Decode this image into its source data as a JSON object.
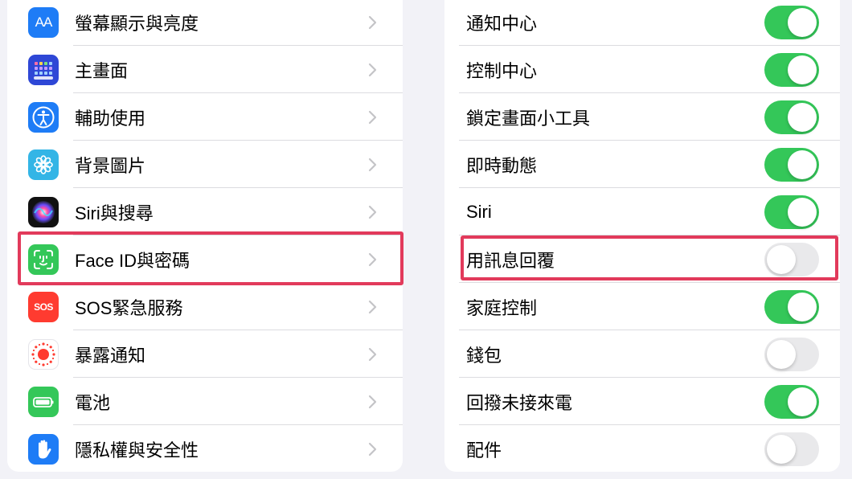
{
  "colors": {
    "toggle_on": "#34c759",
    "toggle_off": "#e9e9eb",
    "highlight": "#e23a5b"
  },
  "left_list": {
    "items": [
      {
        "label": "螢幕顯示與亮度",
        "icon": "text-size-icon",
        "icon_text": "AA"
      },
      {
        "label": "主畫面",
        "icon": "home-screen-grid-icon"
      },
      {
        "label": "輔助使用",
        "icon": "accessibility-icon"
      },
      {
        "label": "背景圖片",
        "icon": "wallpaper-flower-icon"
      },
      {
        "label": "Siri與搜尋",
        "icon": "siri-icon"
      },
      {
        "label": "Face ID與密碼",
        "icon": "face-id-icon",
        "highlighted": true
      },
      {
        "label": "SOS緊急服務",
        "icon": "sos-icon",
        "icon_text": "SOS"
      },
      {
        "label": "暴露通知",
        "icon": "exposure-notification-icon"
      },
      {
        "label": "電池",
        "icon": "battery-icon"
      },
      {
        "label": "隱私權與安全性",
        "icon": "privacy-hand-icon"
      }
    ]
  },
  "right_list": {
    "items": [
      {
        "label": "通知中心",
        "on": true
      },
      {
        "label": "控制中心",
        "on": true
      },
      {
        "label": "鎖定畫面小工具",
        "on": true
      },
      {
        "label": "即時動態",
        "on": true
      },
      {
        "label": "Siri",
        "on": true
      },
      {
        "label": "用訊息回覆",
        "on": false,
        "highlighted": true
      },
      {
        "label": "家庭控制",
        "on": true
      },
      {
        "label": "錢包",
        "on": false
      },
      {
        "label": "回撥未接來電",
        "on": true
      },
      {
        "label": "配件",
        "on": false
      }
    ]
  }
}
